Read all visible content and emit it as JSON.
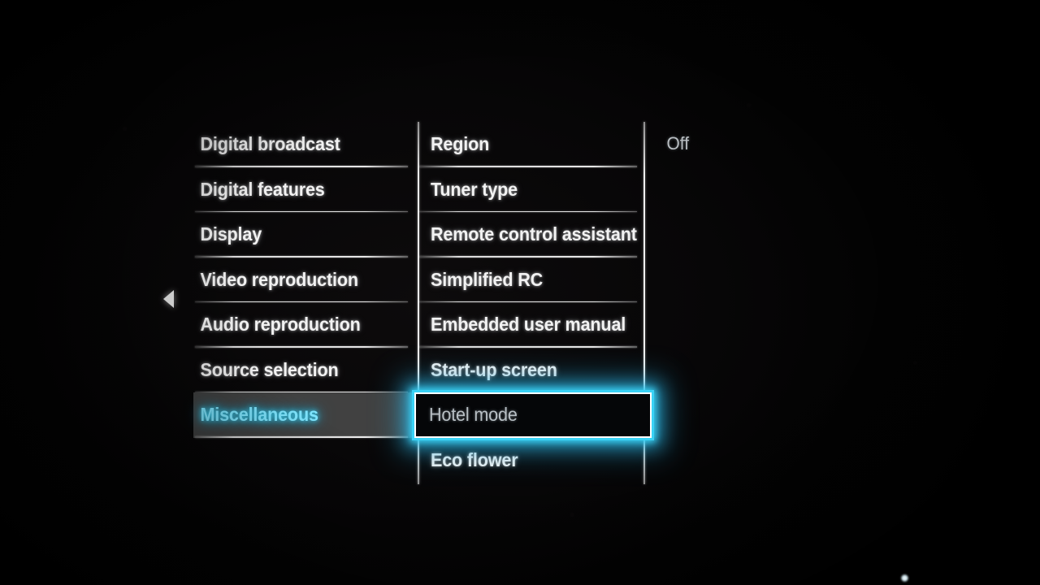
{
  "screen": {
    "device_ui": "TV settings menu",
    "accent_color": "#3ad3f6",
    "highlight_bg_color": "#414141",
    "text_color": "#f2f2f2",
    "dim_text_color": "#b9bec2"
  },
  "nav": {
    "back_arrow_icon": "triangle-left-icon"
  },
  "columns": {
    "left": {
      "name": "settings-categories",
      "items": [
        {
          "label": "Digital broadcast",
          "state": "normal"
        },
        {
          "label": "Digital features",
          "state": "normal"
        },
        {
          "label": "Display",
          "state": "normal"
        },
        {
          "label": "Video reproduction",
          "state": "normal"
        },
        {
          "label": "Audio reproduction",
          "state": "normal"
        },
        {
          "label": "Source selection",
          "state": "normal"
        },
        {
          "label": "Miscellaneous",
          "state": "active"
        }
      ]
    },
    "middle": {
      "name": "miscellaneous-options",
      "items": [
        {
          "label": "Region",
          "state": "normal"
        },
        {
          "label": "Tuner type",
          "state": "normal"
        },
        {
          "label": "Remote control assistant",
          "state": "normal"
        },
        {
          "label": "Simplified RC",
          "state": "normal"
        },
        {
          "label": "Embedded user manual",
          "state": "normal"
        },
        {
          "label": "Start-up screen",
          "state": "normal"
        },
        {
          "label": "Hotel mode",
          "state": "selected"
        },
        {
          "label": "Eco flower",
          "state": "normal"
        }
      ]
    },
    "right": {
      "name": "option-value",
      "value": "Off"
    }
  }
}
